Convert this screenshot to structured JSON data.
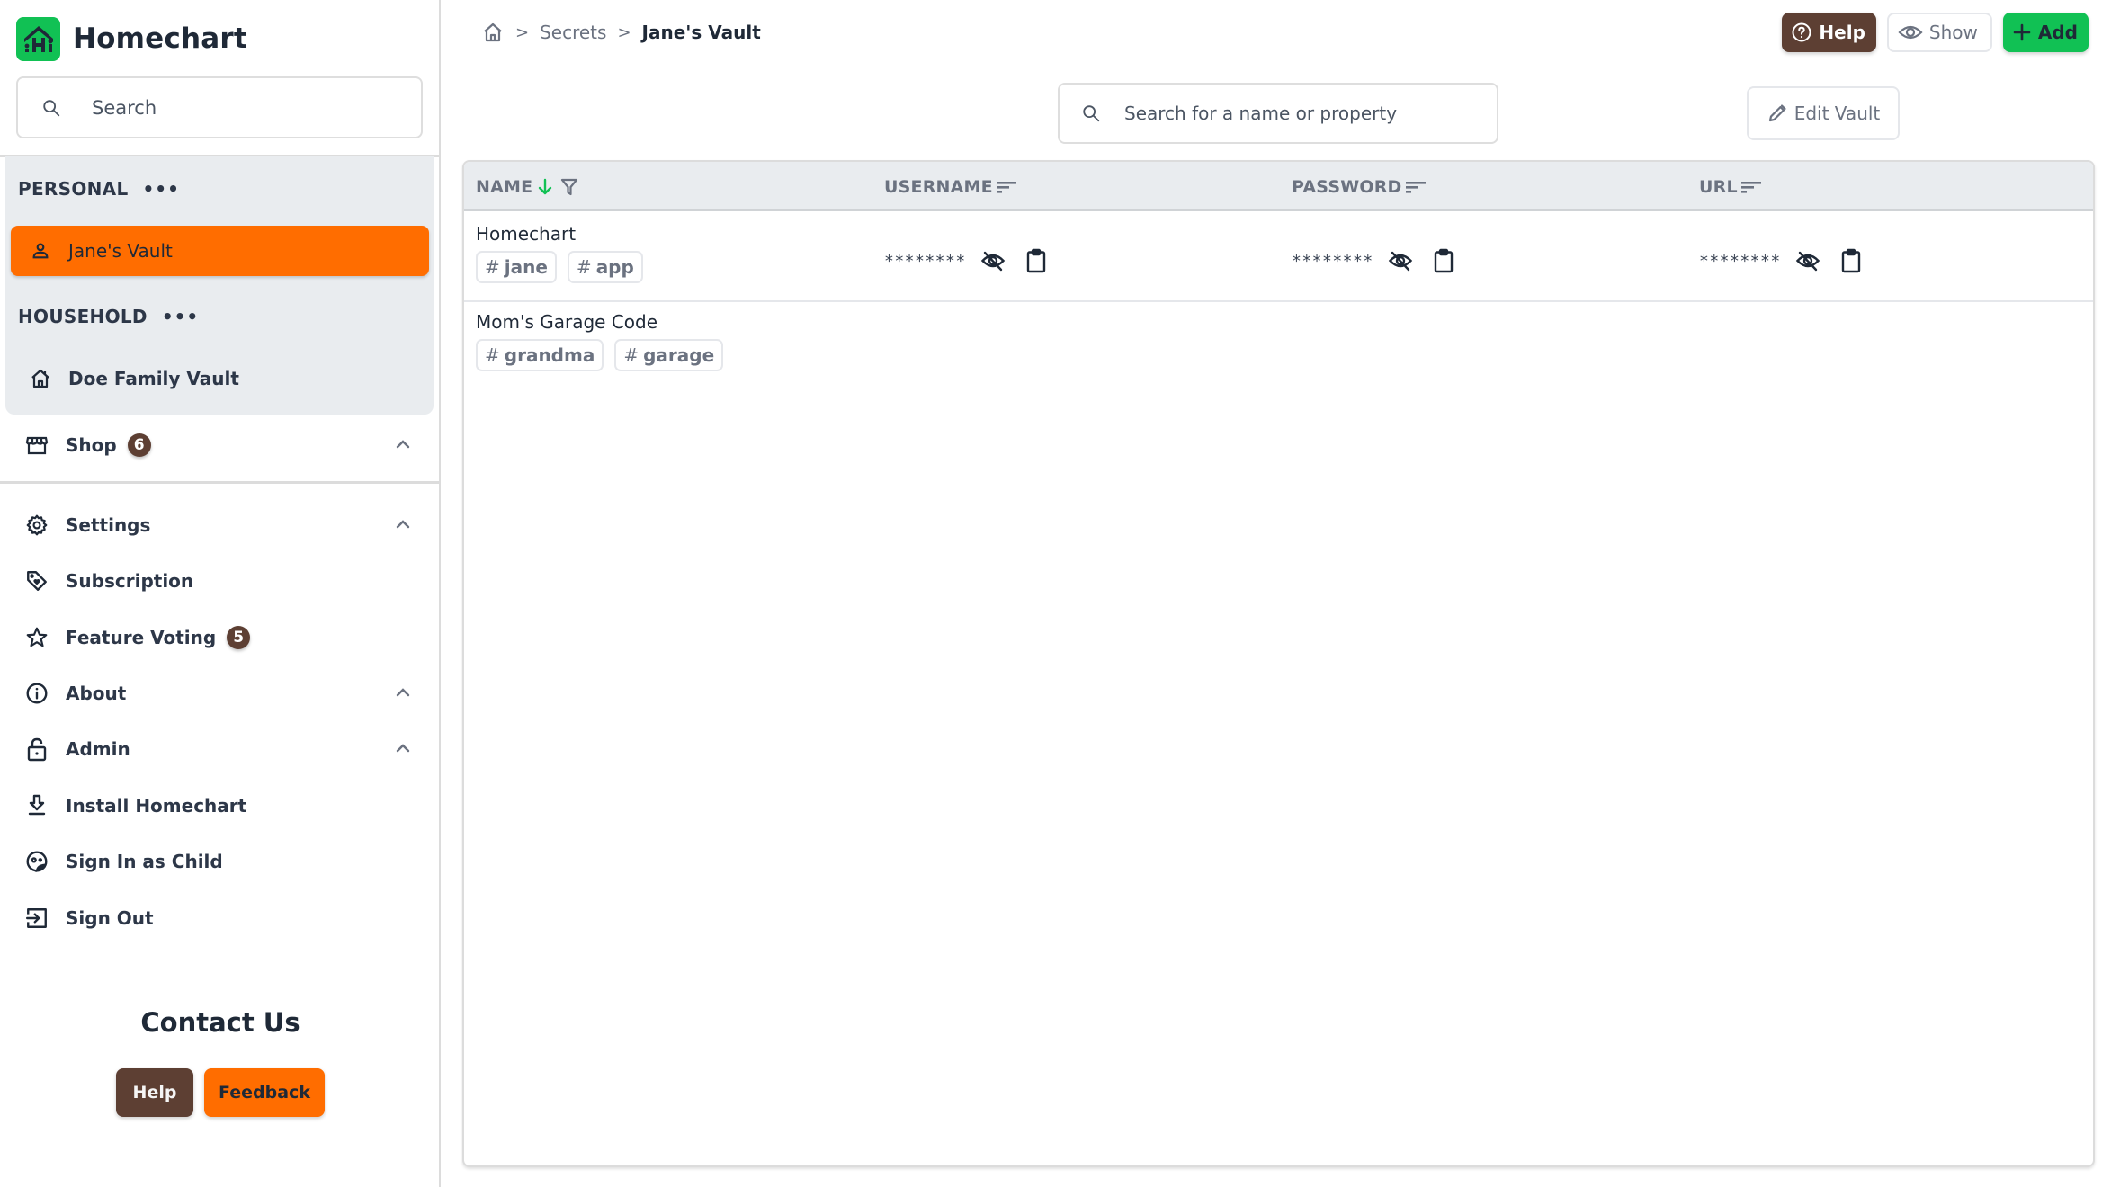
{
  "app": {
    "name": "Homechart"
  },
  "sidebar": {
    "search_placeholder": "Search",
    "groups": [
      {
        "label": "PERSONAL",
        "menu": "•••",
        "items": [
          {
            "label": "Jane's Vault",
            "icon": "person-icon",
            "active": true
          }
        ]
      },
      {
        "label": "HOUSEHOLD",
        "menu": "•••",
        "items": [
          {
            "label": "Doe Family Vault",
            "icon": "house-icon",
            "active": false
          }
        ]
      }
    ],
    "shop": {
      "label": "Shop",
      "badge": "6"
    },
    "nav": [
      {
        "label": "Settings",
        "icon": "gear-icon",
        "expandable": true
      },
      {
        "label": "Subscription",
        "icon": "tag-heart-icon"
      },
      {
        "label": "Feature Voting",
        "icon": "star-icon",
        "badge": "5"
      },
      {
        "label": "About",
        "icon": "info-icon",
        "expandable": true
      },
      {
        "label": "Admin",
        "icon": "unlock-icon",
        "expandable": true
      },
      {
        "label": "Install Homechart",
        "icon": "download-icon"
      },
      {
        "label": "Sign In as Child",
        "icon": "child-face-icon"
      },
      {
        "label": "Sign Out",
        "icon": "sign-out-icon"
      }
    ],
    "contact": {
      "title": "Contact Us",
      "help_label": "Help",
      "feedback_label": "Feedback"
    }
  },
  "breadcrumb": {
    "home": "home-icon",
    "items": [
      "Secrets"
    ],
    "current": "Jane's Vault",
    "separator": ">"
  },
  "toolbar": {
    "help_label": "Help",
    "show_label": "Show",
    "add_label": "Add",
    "edit_label": "Edit Vault"
  },
  "search": {
    "placeholder": "Search for a name or property"
  },
  "colors": {
    "accent_orange": "#ff6d00",
    "brown": "#5d3f33",
    "green": "#11c154"
  },
  "table": {
    "columns": [
      {
        "label": "NAME",
        "sort": "descending",
        "filter": true
      },
      {
        "label": "USERNAME"
      },
      {
        "label": "PASSWORD"
      },
      {
        "label": "URL"
      }
    ],
    "rows": [
      {
        "name": "Homechart",
        "tags": [
          "jane",
          "app"
        ],
        "username": "********",
        "password": "********",
        "url": "********"
      },
      {
        "name": "Mom's Garage Code",
        "tags": [
          "grandma",
          "garage"
        ]
      }
    ]
  }
}
